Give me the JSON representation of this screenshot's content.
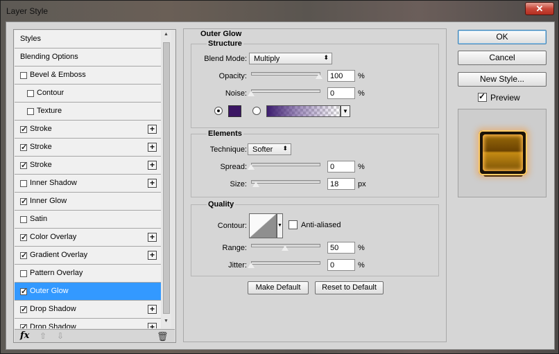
{
  "window": {
    "title": "Layer Style",
    "close_glyph": "✕"
  },
  "style_list": [
    {
      "label": "Styles",
      "checkbox": false,
      "checked": false,
      "indent": 0,
      "plus": false,
      "selected": false
    },
    {
      "label": "Blending Options",
      "checkbox": false,
      "checked": false,
      "indent": 0,
      "plus": false,
      "selected": false
    },
    {
      "label": "Bevel & Emboss",
      "checkbox": true,
      "checked": false,
      "indent": 0,
      "plus": false,
      "selected": false
    },
    {
      "label": "Contour",
      "checkbox": true,
      "checked": false,
      "indent": 1,
      "plus": false,
      "selected": false
    },
    {
      "label": "Texture",
      "checkbox": true,
      "checked": false,
      "indent": 1,
      "plus": false,
      "selected": false
    },
    {
      "label": "Stroke",
      "checkbox": true,
      "checked": true,
      "indent": 0,
      "plus": true,
      "selected": false
    },
    {
      "label": "Stroke",
      "checkbox": true,
      "checked": true,
      "indent": 0,
      "plus": true,
      "selected": false
    },
    {
      "label": "Stroke",
      "checkbox": true,
      "checked": true,
      "indent": 0,
      "plus": true,
      "selected": false
    },
    {
      "label": "Inner Shadow",
      "checkbox": true,
      "checked": false,
      "indent": 0,
      "plus": true,
      "selected": false
    },
    {
      "label": "Inner Glow",
      "checkbox": true,
      "checked": true,
      "indent": 0,
      "plus": false,
      "selected": false
    },
    {
      "label": "Satin",
      "checkbox": true,
      "checked": false,
      "indent": 0,
      "plus": false,
      "selected": false
    },
    {
      "label": "Color Overlay",
      "checkbox": true,
      "checked": true,
      "indent": 0,
      "plus": true,
      "selected": false
    },
    {
      "label": "Gradient Overlay",
      "checkbox": true,
      "checked": true,
      "indent": 0,
      "plus": true,
      "selected": false
    },
    {
      "label": "Pattern Overlay",
      "checkbox": true,
      "checked": false,
      "indent": 0,
      "plus": false,
      "selected": false
    },
    {
      "label": "Outer Glow",
      "checkbox": true,
      "checked": true,
      "indent": 0,
      "plus": false,
      "selected": true
    },
    {
      "label": "Drop Shadow",
      "checkbox": true,
      "checked": true,
      "indent": 0,
      "plus": true,
      "selected": false
    },
    {
      "label": "Drop Shadow",
      "checkbox": true,
      "checked": true,
      "indent": 0,
      "plus": true,
      "selected": false
    }
  ],
  "footer": {
    "fx_label": "fx",
    "up_glyph": "⇧",
    "down_glyph": "⇩",
    "trash_glyph": "🗑"
  },
  "outer_glow": {
    "title": "Outer Glow",
    "structure": {
      "title": "Structure",
      "blend_mode_label": "Blend Mode:",
      "blend_mode_value": "Multiply",
      "opacity_label": "Opacity:",
      "opacity_value": "100",
      "opacity_percent": 100,
      "noise_label": "Noise:",
      "noise_value": "0",
      "noise_percent": 0,
      "glow_color": "#3b1663",
      "percent_unit": "%"
    },
    "elements": {
      "title": "Elements",
      "technique_label": "Technique:",
      "technique_value": "Softer",
      "spread_label": "Spread:",
      "spread_value": "0",
      "spread_percent": 0,
      "size_label": "Size:",
      "size_value": "18",
      "size_fraction": 0.07,
      "percent_unit": "%",
      "px_unit": "px"
    },
    "quality": {
      "title": "Quality",
      "contour_label": "Contour:",
      "anti_aliased_label": "Anti-aliased",
      "range_label": "Range:",
      "range_value": "50",
      "range_percent": 50,
      "jitter_label": "Jitter:",
      "jitter_value": "0",
      "jitter_percent": 0,
      "percent_unit": "%"
    },
    "make_default_label": "Make Default",
    "reset_default_label": "Reset to Default"
  },
  "actions": {
    "ok_label": "OK",
    "cancel_label": "Cancel",
    "new_style_label": "New Style...",
    "preview_label": "Preview",
    "preview_checked": true
  },
  "icons": {
    "dropdown": "⬍",
    "caret": "▼",
    "check": "✓"
  }
}
